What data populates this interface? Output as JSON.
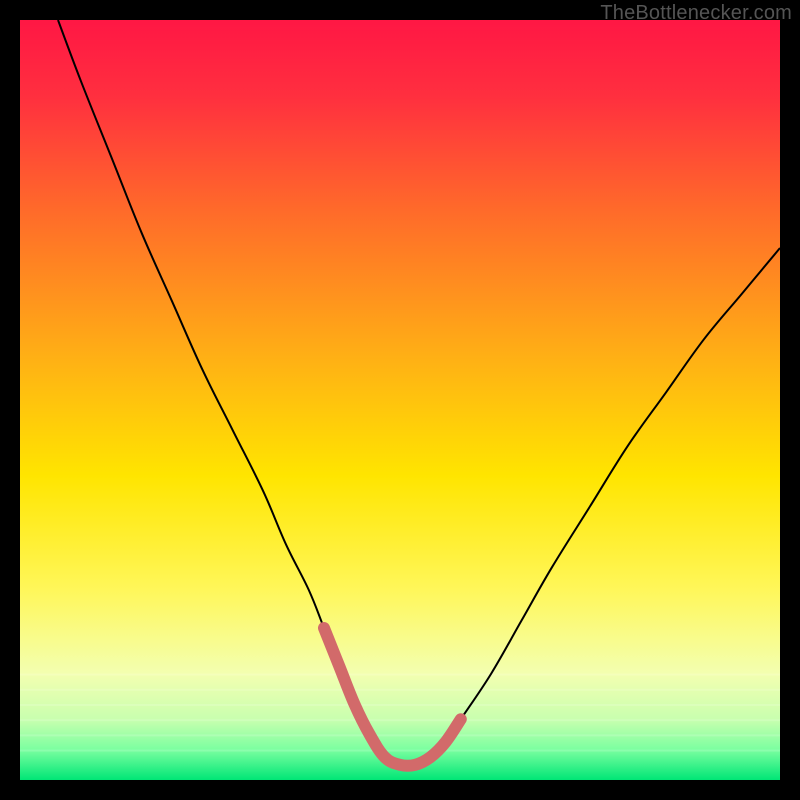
{
  "watermark": "TheBottlenecker.com",
  "chart_data": {
    "type": "line",
    "title": "",
    "xlabel": "",
    "ylabel": "",
    "xlim": [
      0,
      100
    ],
    "ylim": [
      0,
      100
    ],
    "grid": false,
    "background": {
      "kind": "vertical-gradient",
      "stops": [
        {
          "offset": 0.0,
          "color": "#ff1744"
        },
        {
          "offset": 0.1,
          "color": "#ff2f3f"
        },
        {
          "offset": 0.25,
          "color": "#ff6a2a"
        },
        {
          "offset": 0.45,
          "color": "#ffb214"
        },
        {
          "offset": 0.6,
          "color": "#ffe500"
        },
        {
          "offset": 0.75,
          "color": "#fff75a"
        },
        {
          "offset": 0.86,
          "color": "#f3ffb0"
        },
        {
          "offset": 0.92,
          "color": "#c9ffaf"
        },
        {
          "offset": 0.96,
          "color": "#7bffa0"
        },
        {
          "offset": 1.0,
          "color": "#00e676"
        }
      ]
    },
    "series": [
      {
        "name": "bottleneck-curve",
        "kind": "curve",
        "stroke": "#000000",
        "stroke_width": 2,
        "x": [
          5,
          8,
          12,
          16,
          20,
          24,
          28,
          32,
          35,
          38,
          40,
          42,
          44,
          46,
          48,
          50,
          52,
          54,
          56,
          58,
          62,
          66,
          70,
          75,
          80,
          85,
          90,
          95,
          100
        ],
        "y": [
          100,
          92,
          82,
          72,
          63,
          54,
          46,
          38,
          31,
          25,
          20,
          15,
          10,
          6,
          3,
          2,
          2,
          3,
          5,
          8,
          14,
          21,
          28,
          36,
          44,
          51,
          58,
          64,
          70
        ]
      },
      {
        "name": "optimal-zone-marker",
        "kind": "curve",
        "stroke": "#d26a6a",
        "stroke_width": 12,
        "linecap": "round",
        "x": [
          40,
          42,
          44,
          46,
          48,
          50,
          52,
          54,
          56,
          58
        ],
        "y": [
          20,
          15,
          10,
          6,
          3,
          2,
          2,
          3,
          5,
          8
        ]
      }
    ]
  }
}
